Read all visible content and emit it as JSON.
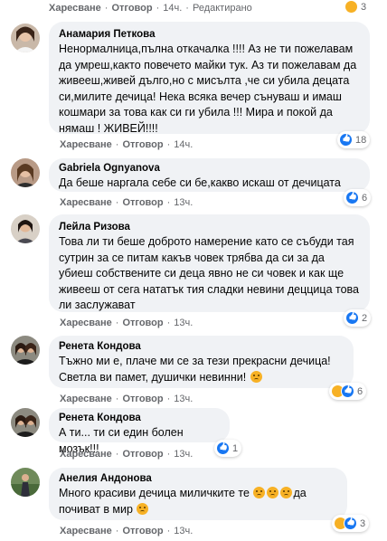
{
  "top": {
    "like": "Харесване",
    "reply": "Отговор",
    "time": "14ч.",
    "edited": "Редактирано",
    "reaction_count": "3"
  },
  "comments": [
    {
      "author": "Анамария Петкова",
      "text": "Ненормалница,пълна откачалка !!!! Аз не ти пожелавам да умреш,както повечето майки тук. Аз ти пожелавам да живееш,живей дълго,но с мисълта ,че си убила децата си,милите дечица! Нека всяка вечер сънуваш и имаш кошмари за това как си ги убила !!! Мира и покой да нямаш ! ЖИВЕЙ!!!!",
      "like": "Харесване",
      "reply": "Отговор",
      "time": "14ч.",
      "reaction_count": "18"
    },
    {
      "author": "Gabriela Ognyanova",
      "text": "Да беше наргала себе си бе,какво искаш от дечицата",
      "like": "Харесване",
      "reply": "Отговор",
      "time": "13ч.",
      "reaction_count": "6"
    },
    {
      "author": "Лейла Ризова",
      "text": "Това ли ти беше доброто намерение като се събуди тая сутрин за се питам какъв човек трябва да си за да убиеш собствените си деца явно не си човек и как ще живееш от сега нататък тия сладки невини деццица това ли заслужават",
      "like": "Харесване",
      "reply": "Отговор",
      "time": "13ч.",
      "reaction_count": "2"
    },
    {
      "author": "Ренета Кондова",
      "text_line1": "Тъжно ми е, плаче ми се за тези прекрасни дечица!",
      "text_line2": "Светла ви памет, душички невинни!",
      "like": "Харесване",
      "reply": "Отговор",
      "time": "13ч.",
      "reaction_count": "6"
    },
    {
      "author": "Ренета Кондова",
      "text": "А ти... ти си един болен мозък!!!",
      "like": "Харесване",
      "reply": "Отговор",
      "time": "13ч.",
      "reaction_count": "1"
    },
    {
      "author": "Анелия Андонова",
      "text_part1": "Много красиви дечица миличките те",
      "text_part2": "да",
      "text_line2": "почиват в мир",
      "like": "Харесване",
      "reply": "Отговор",
      "time": "13ч.",
      "reaction_count": "3"
    }
  ],
  "colors": {
    "bubble": "#f0f2f5",
    "meta": "#65676b",
    "like_blue": "#1877f2",
    "sad_yellow": "#f7b125"
  }
}
